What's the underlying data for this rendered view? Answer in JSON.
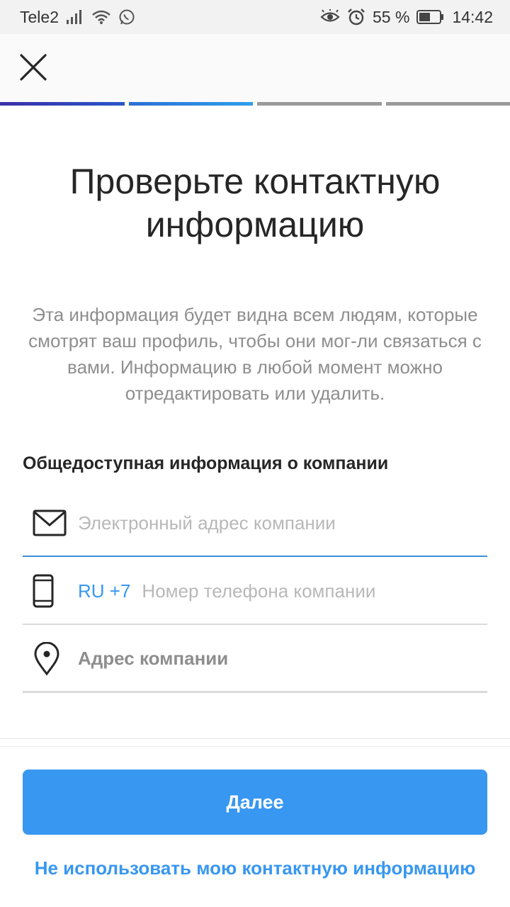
{
  "status_bar": {
    "carrier": "Tele2",
    "battery": "55 %",
    "time": "14:42",
    "icons": [
      "signal-icon",
      "wifi-icon",
      "whatsapp-icon",
      "eye-icon",
      "alarm-icon",
      "battery-icon"
    ]
  },
  "header": {
    "close_icon": "close-icon"
  },
  "progress": {
    "total_steps": 4,
    "completed_steps": 2
  },
  "main": {
    "title": "Проверьте контактную информацию",
    "subtitle": "Эта информация будет видна всем людям, которые смотрят ваш профиль, чтобы они мог-ли связаться с вами. Информацию в любой момент можно отредактировать или удалить.",
    "section_label": "Общедоступная информация о компании",
    "email_field": {
      "icon": "mail-icon",
      "placeholder": "Электронный адрес компании",
      "value": ""
    },
    "phone_field": {
      "icon": "phone-icon",
      "country_code": "RU +7",
      "placeholder": "Номер телефона компании",
      "value": ""
    },
    "address_field": {
      "icon": "location-pin-icon",
      "label": "Адрес компании"
    }
  },
  "footer": {
    "next_label": "Далее",
    "skip_label": "Не использовать мою контактную информацию"
  },
  "colors": {
    "accent": "#3897f0",
    "text": "#262626",
    "secondary_text": "#8e8e8e"
  }
}
